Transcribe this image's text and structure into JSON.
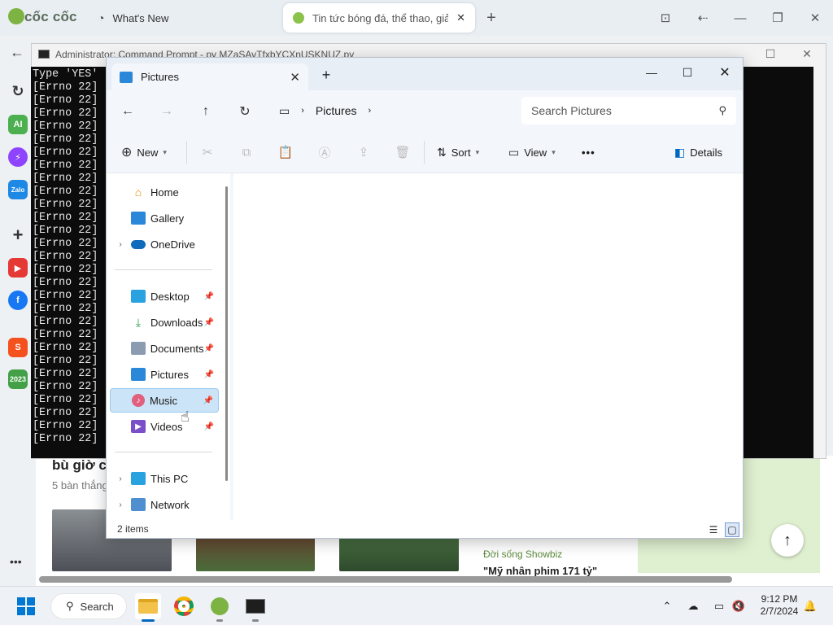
{
  "browser": {
    "logo": "cốc cốc",
    "tabs": [
      {
        "label": "What's New"
      },
      {
        "label": "Tin tức bóng đá, thể thao, giả"
      }
    ],
    "sidebar_icons": [
      "history-icon",
      "ai-icon",
      "messenger-icon",
      "zalo-icon",
      "add-icon",
      "youtube-icon",
      "facebook-icon",
      "shopee-icon",
      "calendar-2023-icon"
    ],
    "ai_label": "AI",
    "zalo_label": "Zalo",
    "calendar_label": "2023",
    "web": {
      "headline": "bù giờ c",
      "subline": "5 bàn thắng",
      "category": "Đời sống Showbiz",
      "article_title": "\"Mỹ nhân phim 171 tỷ\""
    }
  },
  "cmd": {
    "title": "Administrator: Command Prompt - py  MZaSAvTfxbYCXnUSKNUZ.py",
    "lines": [
      "Type 'YES'",
      "[Errno 22]",
      "[Errno 22]",
      "[Errno 22]",
      "[Errno 22]",
      "[Errno 22]",
      "[Errno 22]",
      "[Errno 22]",
      "[Errno 22]",
      "[Errno 22]",
      "[Errno 22]",
      "[Errno 22]",
      "[Errno 22]",
      "[Errno 22]",
      "[Errno 22]",
      "[Errno 22]",
      "[Errno 22]",
      "[Errno 22]",
      "[Errno 22]",
      "[Errno 22]",
      "[Errno 22]",
      "[Errno 22]",
      "[Errno 22]",
      "[Errno 22]",
      "[Errno 22]",
      "[Errno 22]",
      "[Errno 22]",
      "[Errno 22]",
      "[Errno 22]"
    ]
  },
  "explorer": {
    "tab_title": "Pictures",
    "breadcrumb": "Pictures",
    "search_placeholder": "Search Pictures",
    "toolbar": {
      "new_label": "New",
      "sort_label": "Sort",
      "view_label": "View",
      "more_label": "•••",
      "details_label": "Details"
    },
    "nav_items": [
      {
        "label": "Home"
      },
      {
        "label": "Gallery"
      },
      {
        "label": "OneDrive"
      },
      {
        "label": "Desktop"
      },
      {
        "label": "Downloads"
      },
      {
        "label": "Documents"
      },
      {
        "label": "Pictures"
      },
      {
        "label": "Music"
      },
      {
        "label": "Videos"
      },
      {
        "label": "This PC"
      },
      {
        "label": "Network"
      }
    ],
    "status": "2 items"
  },
  "taskbar": {
    "search_label": "Search",
    "time": "9:12 PM",
    "date": "2/7/2024"
  },
  "colors": {
    "explorer_selected": "#cce4f7",
    "console_bg": "#0c0c0c",
    "accent": "#0067c0"
  }
}
